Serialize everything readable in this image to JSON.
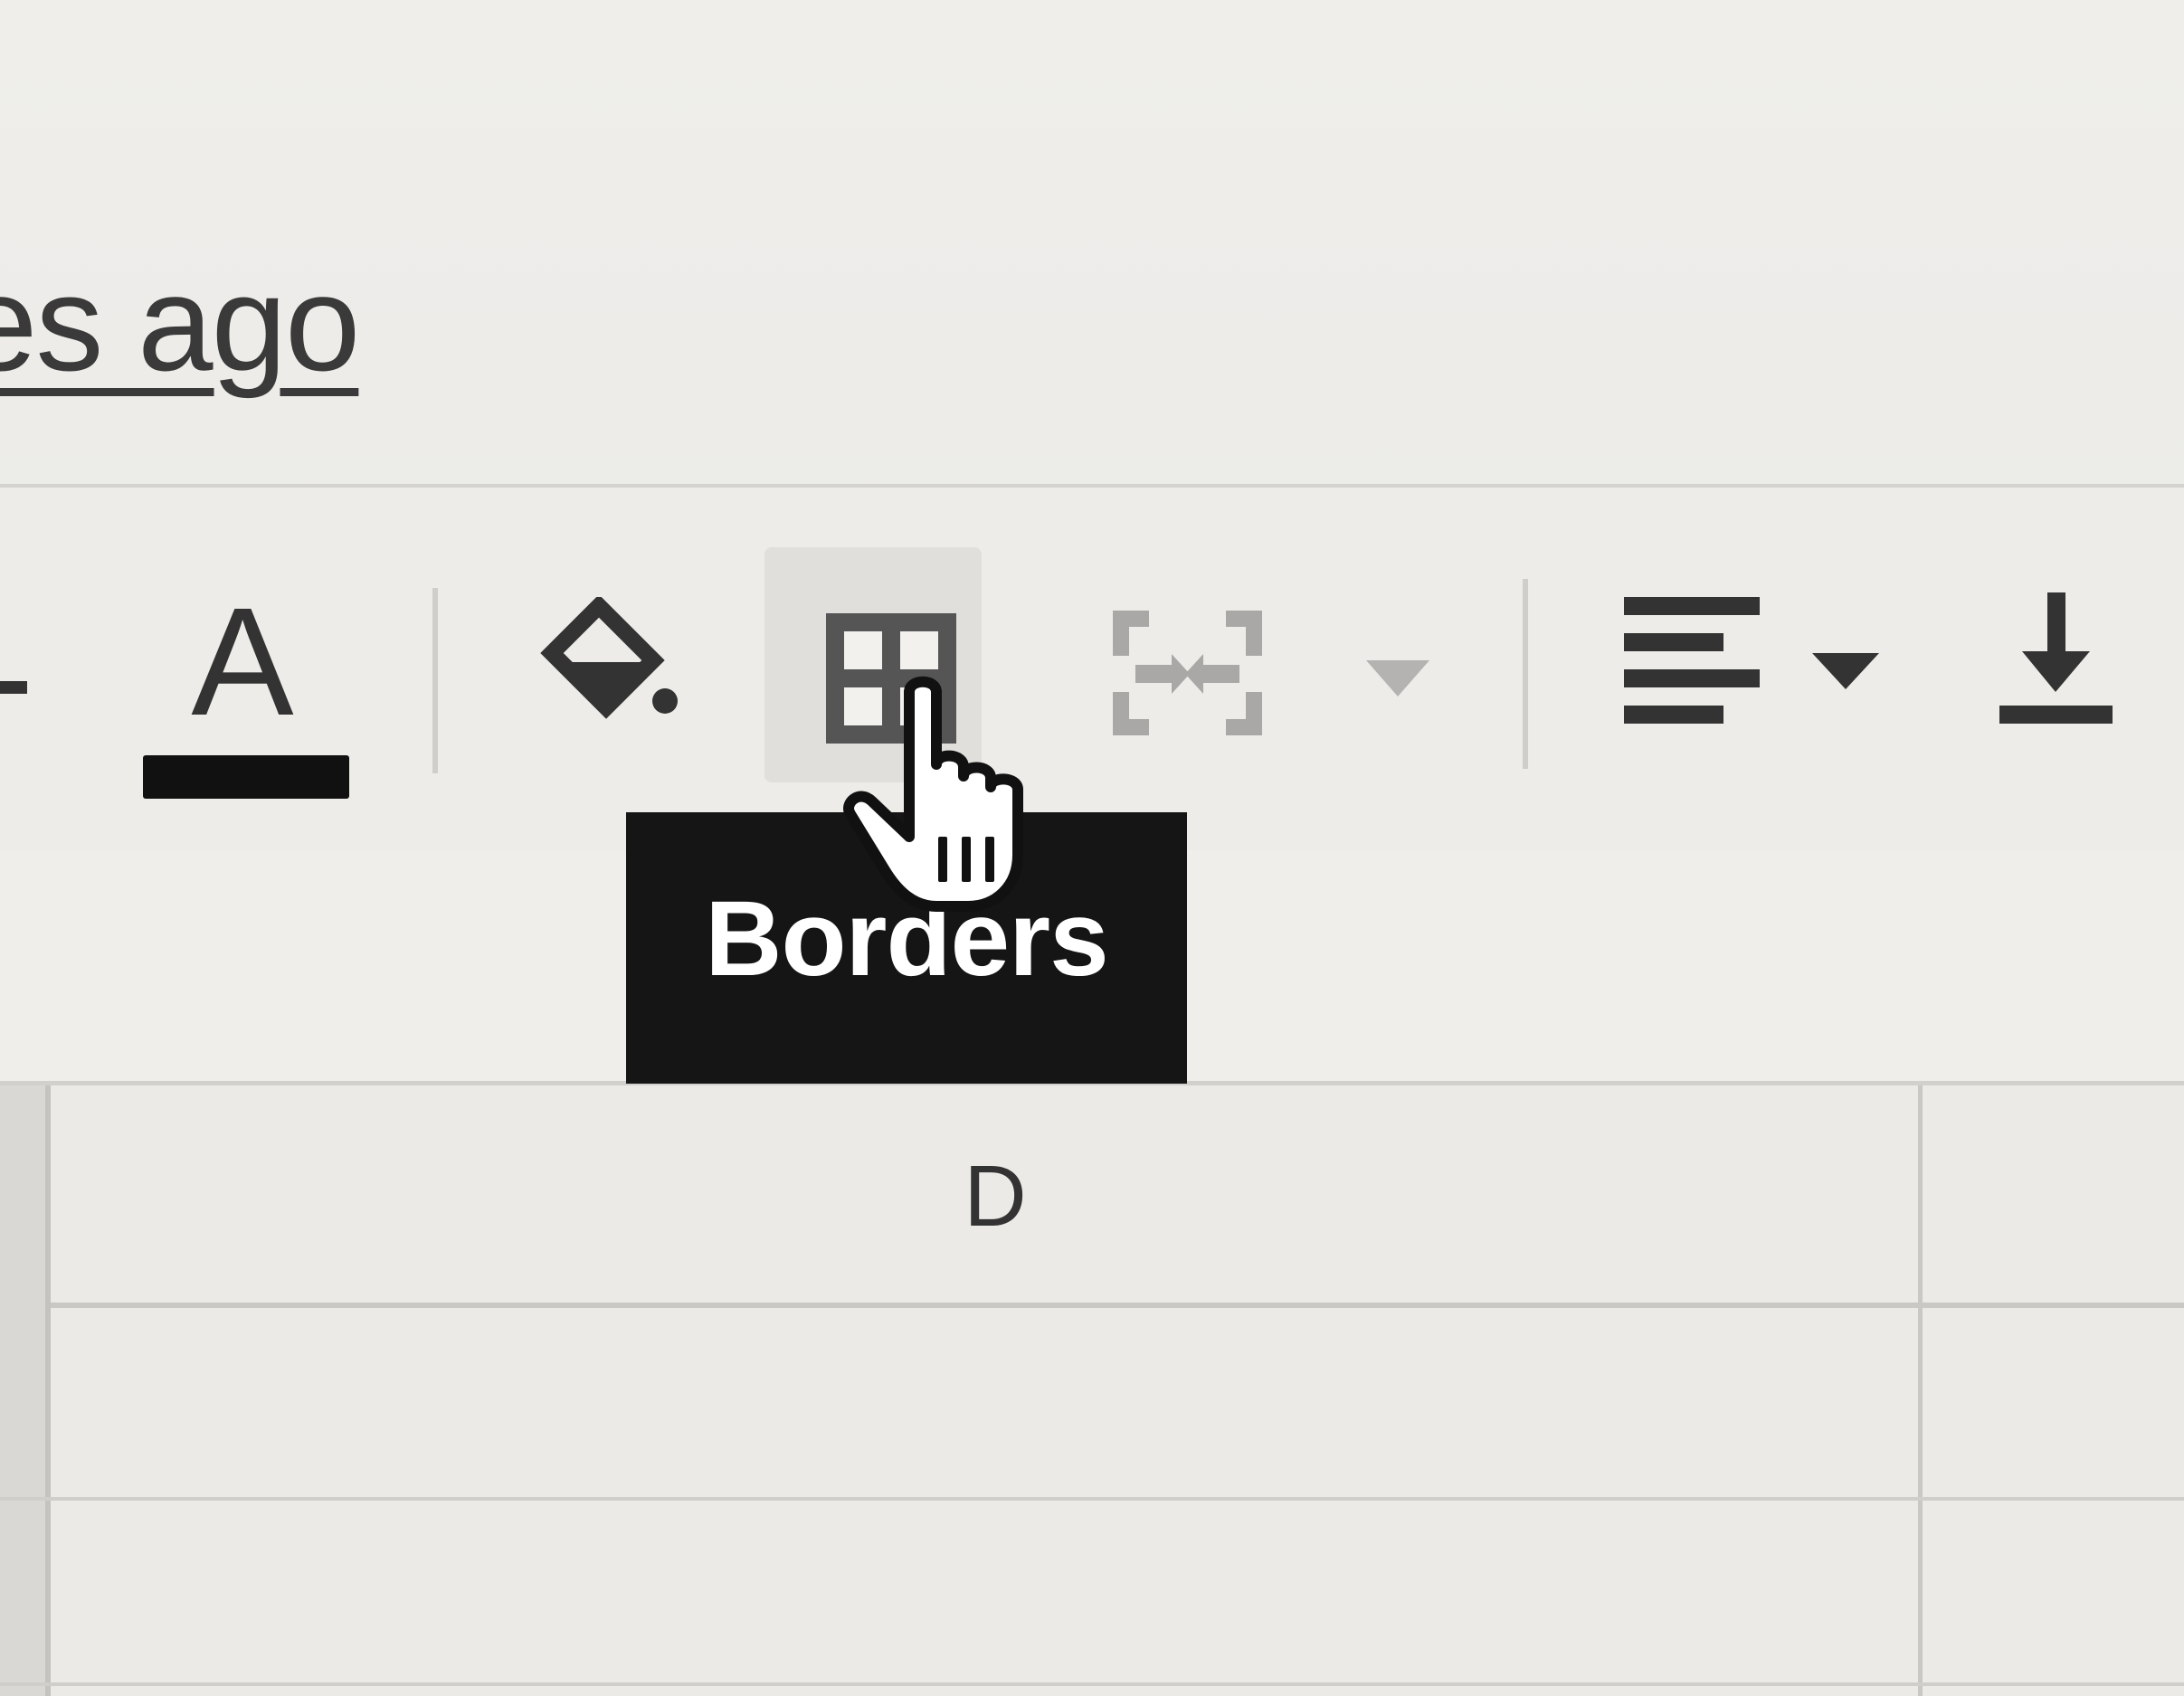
{
  "header": {
    "last_edit_text": "es ago"
  },
  "toolbar": {
    "items": [
      {
        "name": "partial-icon-left",
        "icon": "dash-icon"
      },
      {
        "name": "text-color",
        "icon": "text-color-icon",
        "letter": "A",
        "swatch_color": "#111111"
      },
      {
        "name": "fill-color",
        "icon": "paint-bucket-icon"
      },
      {
        "name": "borders",
        "icon": "borders-icon"
      },
      {
        "name": "merge-cells",
        "icon": "merge-cells-icon"
      },
      {
        "name": "merge-dropdown",
        "icon": "chevron-down-icon"
      },
      {
        "name": "horizontal-align",
        "icon": "align-left-icon"
      },
      {
        "name": "align-dropdown",
        "icon": "chevron-down-icon"
      },
      {
        "name": "vertical-align",
        "icon": "align-bottom-icon"
      }
    ]
  },
  "tooltip": {
    "text": "Borders"
  },
  "grid": {
    "column_headers": [
      "D"
    ]
  },
  "colors": {
    "tooltip_bg": "#151515",
    "tooltip_text": "#ffffff",
    "icon": "#333333",
    "icon_disabled": "#a9a8a6"
  }
}
